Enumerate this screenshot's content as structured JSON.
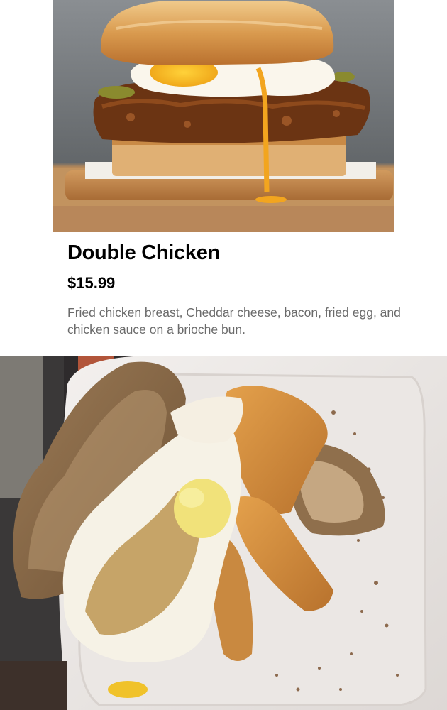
{
  "menu_item": {
    "title": "Double Chicken",
    "price": "$15.99",
    "description": "Fried chicken breast, Cheddar cheese, bacon, fried egg, and chicken sauce on a brioche bun."
  },
  "images": {
    "hero_subject": "sandwich-photo",
    "received_subject": "takeout-container-photo"
  },
  "colors": {
    "title": "#000000",
    "price": "#000000",
    "description": "#6b6b6b",
    "background": "#ffffff"
  }
}
